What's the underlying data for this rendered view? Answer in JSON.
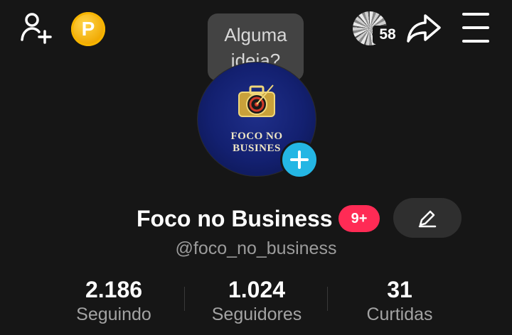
{
  "top_bar": {
    "coin_letter": "P",
    "story_count": "58"
  },
  "tooltip": {
    "line1": "Alguma",
    "line2": "ideia?"
  },
  "avatar": {
    "text_line1": "FOCO NO",
    "text_line2": "BUSINES"
  },
  "profile": {
    "display_name": "Foco no Business",
    "notification_badge": "9+",
    "username": "@foco_no_business"
  },
  "stats": [
    {
      "value": "2.186",
      "label": "Seguindo"
    },
    {
      "value": "1.024",
      "label": "Seguidores"
    },
    {
      "value": "31",
      "label": "Curtidas"
    }
  ],
  "colors": {
    "background": "#161616",
    "badge": "#ff2b55",
    "add_photo": "#24b6e4",
    "coin": "#f6b500"
  }
}
